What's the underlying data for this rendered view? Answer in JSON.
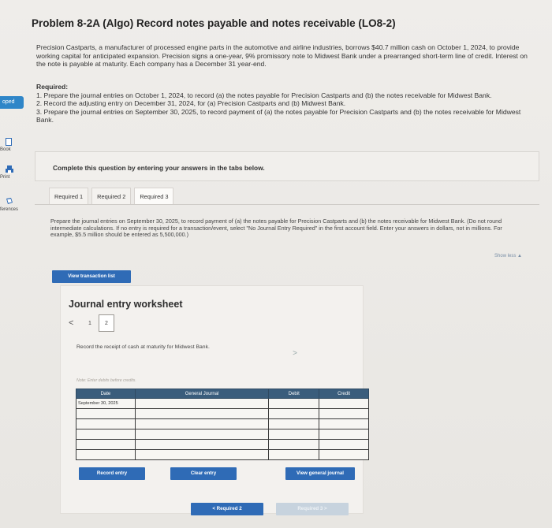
{
  "sidebar": {
    "badge": "oped",
    "items": [
      {
        "label": "Book",
        "icon": "book-icon"
      },
      {
        "label": "Print",
        "icon": "print-icon"
      },
      {
        "label": "ferences",
        "icon": "references-icon"
      }
    ]
  },
  "title": "Problem 8-2A (Algo) Record notes payable and notes receivable (LO8-2)",
  "intro": "Precision Castparts, a manufacturer of processed engine parts in the automotive and airline industries, borrows $40.7 million cash on October 1, 2024, to provide working capital for anticipated expansion. Precision signs a one-year, 9% promissory note to Midwest Bank under a prearranged short-term line of credit. Interest on the note is payable at maturity. Each company has a December 31 year-end.",
  "required": {
    "heading": "Required:",
    "items": [
      "1. Prepare the journal entries on October 1, 2024, to record (a) the notes payable for Precision Castparts and (b) the notes receivable for Midwest Bank.",
      "2. Record the adjusting entry on December 31, 2024, for (a) Precision Castparts and (b) Midwest Bank.",
      "3. Prepare the journal entries on September 30, 2025, to record payment of (a) the notes payable for Precision Castparts and (b) the notes receivable for Midwest Bank."
    ]
  },
  "card_text": "Complete this question by entering your answers in the tabs below.",
  "tabs": [
    {
      "label": "Required 1"
    },
    {
      "label": "Required 2"
    },
    {
      "label": "Required 3"
    }
  ],
  "active_tab": 2,
  "instructions": "Prepare the journal entries on September 30, 2025, to record payment of (a) the notes payable for Precision Castparts and (b) the notes receivable for Midwest Bank. (Do not round intermediate calculations. If no entry is required for a transaction/event, select \"No Journal Entry Required\" in the first account field. Enter your answers in dollars, not in millions. For example, $5.5 million should be entered as 5,500,000.)",
  "show_less": "Show less ▲",
  "view_transaction_list": "View transaction list",
  "worksheet": {
    "title": "Journal entry worksheet",
    "prev": "<",
    "pages": [
      "1",
      "2"
    ],
    "active_page": 1,
    "next": ">",
    "description": "Record the receipt of cash at maturity for Midwest Bank.",
    "note": "Note: Enter debits before credits.",
    "table": {
      "headers": [
        "Date",
        "General Journal",
        "Debit",
        "Credit"
      ],
      "rows": [
        [
          "September 30, 2025",
          "",
          "",
          ""
        ],
        [
          "",
          "",
          "",
          ""
        ],
        [
          "",
          "",
          "",
          ""
        ],
        [
          "",
          "",
          "",
          ""
        ],
        [
          "",
          "",
          "",
          ""
        ],
        [
          "",
          "",
          "",
          ""
        ]
      ]
    },
    "record_entry": "Record entry",
    "clear_entry": "Clear entry",
    "view_general_journal": "View general journal"
  },
  "bottom_nav": {
    "prev": "< Required 2",
    "next": "Required 3 >"
  }
}
